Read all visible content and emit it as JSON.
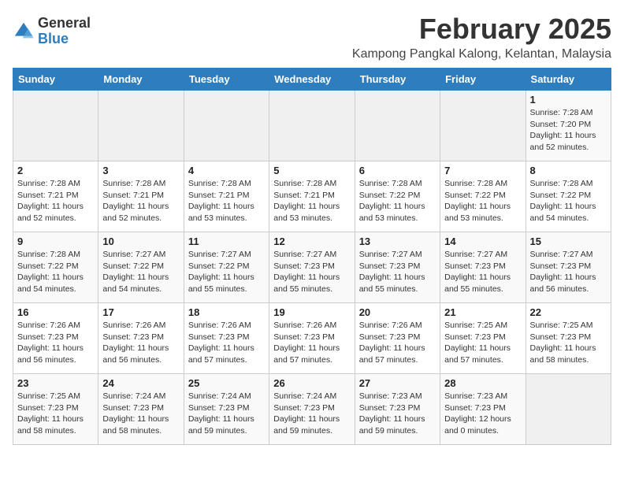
{
  "logo": {
    "general": "General",
    "blue": "Blue"
  },
  "header": {
    "month_title": "February 2025",
    "subtitle": "Kampong Pangkal Kalong, Kelantan, Malaysia"
  },
  "weekdays": [
    "Sunday",
    "Monday",
    "Tuesday",
    "Wednesday",
    "Thursday",
    "Friday",
    "Saturday"
  ],
  "weeks": [
    [
      {
        "day": "",
        "info": ""
      },
      {
        "day": "",
        "info": ""
      },
      {
        "day": "",
        "info": ""
      },
      {
        "day": "",
        "info": ""
      },
      {
        "day": "",
        "info": ""
      },
      {
        "day": "",
        "info": ""
      },
      {
        "day": "1",
        "info": "Sunrise: 7:28 AM\nSunset: 7:20 PM\nDaylight: 11 hours\nand 52 minutes."
      }
    ],
    [
      {
        "day": "2",
        "info": "Sunrise: 7:28 AM\nSunset: 7:21 PM\nDaylight: 11 hours\nand 52 minutes."
      },
      {
        "day": "3",
        "info": "Sunrise: 7:28 AM\nSunset: 7:21 PM\nDaylight: 11 hours\nand 52 minutes."
      },
      {
        "day": "4",
        "info": "Sunrise: 7:28 AM\nSunset: 7:21 PM\nDaylight: 11 hours\nand 53 minutes."
      },
      {
        "day": "5",
        "info": "Sunrise: 7:28 AM\nSunset: 7:21 PM\nDaylight: 11 hours\nand 53 minutes."
      },
      {
        "day": "6",
        "info": "Sunrise: 7:28 AM\nSunset: 7:22 PM\nDaylight: 11 hours\nand 53 minutes."
      },
      {
        "day": "7",
        "info": "Sunrise: 7:28 AM\nSunset: 7:22 PM\nDaylight: 11 hours\nand 53 minutes."
      },
      {
        "day": "8",
        "info": "Sunrise: 7:28 AM\nSunset: 7:22 PM\nDaylight: 11 hours\nand 54 minutes."
      }
    ],
    [
      {
        "day": "9",
        "info": "Sunrise: 7:28 AM\nSunset: 7:22 PM\nDaylight: 11 hours\nand 54 minutes."
      },
      {
        "day": "10",
        "info": "Sunrise: 7:27 AM\nSunset: 7:22 PM\nDaylight: 11 hours\nand 54 minutes."
      },
      {
        "day": "11",
        "info": "Sunrise: 7:27 AM\nSunset: 7:22 PM\nDaylight: 11 hours\nand 55 minutes."
      },
      {
        "day": "12",
        "info": "Sunrise: 7:27 AM\nSunset: 7:23 PM\nDaylight: 11 hours\nand 55 minutes."
      },
      {
        "day": "13",
        "info": "Sunrise: 7:27 AM\nSunset: 7:23 PM\nDaylight: 11 hours\nand 55 minutes."
      },
      {
        "day": "14",
        "info": "Sunrise: 7:27 AM\nSunset: 7:23 PM\nDaylight: 11 hours\nand 55 minutes."
      },
      {
        "day": "15",
        "info": "Sunrise: 7:27 AM\nSunset: 7:23 PM\nDaylight: 11 hours\nand 56 minutes."
      }
    ],
    [
      {
        "day": "16",
        "info": "Sunrise: 7:26 AM\nSunset: 7:23 PM\nDaylight: 11 hours\nand 56 minutes."
      },
      {
        "day": "17",
        "info": "Sunrise: 7:26 AM\nSunset: 7:23 PM\nDaylight: 11 hours\nand 56 minutes."
      },
      {
        "day": "18",
        "info": "Sunrise: 7:26 AM\nSunset: 7:23 PM\nDaylight: 11 hours\nand 57 minutes."
      },
      {
        "day": "19",
        "info": "Sunrise: 7:26 AM\nSunset: 7:23 PM\nDaylight: 11 hours\nand 57 minutes."
      },
      {
        "day": "20",
        "info": "Sunrise: 7:26 AM\nSunset: 7:23 PM\nDaylight: 11 hours\nand 57 minutes."
      },
      {
        "day": "21",
        "info": "Sunrise: 7:25 AM\nSunset: 7:23 PM\nDaylight: 11 hours\nand 57 minutes."
      },
      {
        "day": "22",
        "info": "Sunrise: 7:25 AM\nSunset: 7:23 PM\nDaylight: 11 hours\nand 58 minutes."
      }
    ],
    [
      {
        "day": "23",
        "info": "Sunrise: 7:25 AM\nSunset: 7:23 PM\nDaylight: 11 hours\nand 58 minutes."
      },
      {
        "day": "24",
        "info": "Sunrise: 7:24 AM\nSunset: 7:23 PM\nDaylight: 11 hours\nand 58 minutes."
      },
      {
        "day": "25",
        "info": "Sunrise: 7:24 AM\nSunset: 7:23 PM\nDaylight: 11 hours\nand 59 minutes."
      },
      {
        "day": "26",
        "info": "Sunrise: 7:24 AM\nSunset: 7:23 PM\nDaylight: 11 hours\nand 59 minutes."
      },
      {
        "day": "27",
        "info": "Sunrise: 7:23 AM\nSunset: 7:23 PM\nDaylight: 11 hours\nand 59 minutes."
      },
      {
        "day": "28",
        "info": "Sunrise: 7:23 AM\nSunset: 7:23 PM\nDaylight: 12 hours\nand 0 minutes."
      },
      {
        "day": "",
        "info": ""
      }
    ]
  ]
}
